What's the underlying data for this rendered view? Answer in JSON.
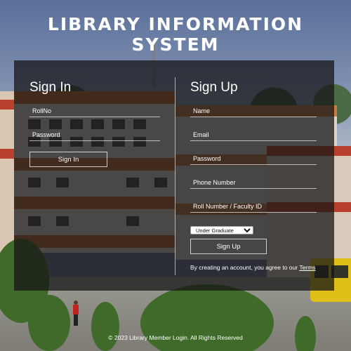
{
  "title": "LIBRARY INFORMATION SYSTEM",
  "signin": {
    "heading": "Sign In",
    "rollno_placeholder": "RollNo",
    "password_placeholder": "Password",
    "button": "Sign In"
  },
  "signup": {
    "heading": "Sign Up",
    "name_placeholder": "Name",
    "email_placeholder": "Email",
    "password_placeholder": "Password",
    "phone_placeholder": "Phone Number",
    "rollid_placeholder": "Roll Number / Faculty ID",
    "category_selected": "Under Graduate",
    "button": "Sign Up",
    "terms_text": "By creating an account, you agree to our ",
    "terms_link": "Terms"
  },
  "footer": "© 2023 Library Member Login. All Rights Reserved",
  "colors": {
    "panel_overlay": "#141416",
    "text": "#ffffff"
  }
}
